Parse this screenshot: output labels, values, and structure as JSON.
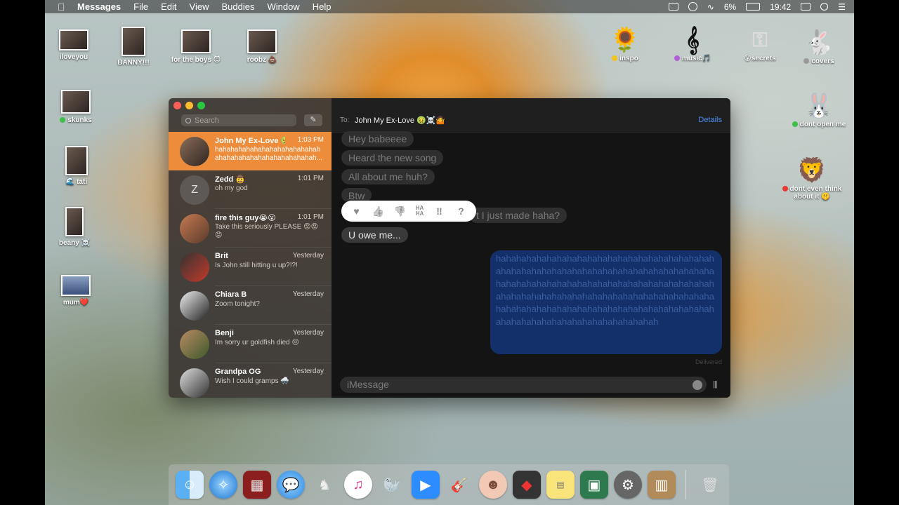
{
  "menubar": {
    "app_name": "Messages",
    "menus": [
      "File",
      "Edit",
      "View",
      "Buddies",
      "Window",
      "Help"
    ],
    "battery": "6%",
    "clock": "19:42"
  },
  "desktop": {
    "left_icons": [
      {
        "label": "iloveyou"
      },
      {
        "label": "BANNY!!!"
      },
      {
        "label": "for the boys 😈"
      },
      {
        "label": "roobz 💩"
      },
      {
        "label": "skunks"
      },
      {
        "label": "🌊 tati"
      },
      {
        "label": "beany ☠️"
      },
      {
        "label": "mum❤️"
      }
    ],
    "right_icons": [
      {
        "label": "inspo",
        "tag_color": "#f0c419"
      },
      {
        "label": "music🎵",
        "tag_color": "#b25ed8"
      },
      {
        "label": "😮secrets",
        "tag_color": ""
      },
      {
        "label": "covers",
        "tag_color": "#9a9a9a"
      },
      {
        "label": "dont open me",
        "tag_color": "#3fbf4a"
      },
      {
        "label": "dont even think about it 🤫",
        "tag_color": "#e53935"
      }
    ]
  },
  "sidebar": {
    "search_placeholder": "Search",
    "conversations": [
      {
        "name": "John My Ex-Love 🤢…",
        "time": "1:03 PM",
        "preview": "hahahahahahahahahahahahahahahahahahahahahahahahahahah...",
        "active": true
      },
      {
        "name": "Zedd 🤠",
        "time": "1:01 PM",
        "preview": "oh my god",
        "letter": "Z"
      },
      {
        "name": "fire this guy😭😮",
        "time": "1:01 PM",
        "preview": "Take this seriously PLEASE 😡😡😡"
      },
      {
        "name": "Brit",
        "time": "Yesterday",
        "preview": "Is John still hitting u up?!?!"
      },
      {
        "name": "Chiara B",
        "time": "Yesterday",
        "preview": "Zoom tonight?"
      },
      {
        "name": "Benji",
        "time": "Yesterday",
        "preview": "Im sorry ur goldfish died 😔"
      },
      {
        "name": "Grandpa OG",
        "time": "Yesterday",
        "preview": "Wish I could gramps 🌨️"
      }
    ]
  },
  "chat": {
    "to_label": "To:",
    "recipient": "John My Ex-Love 🤢☠️🤷",
    "details_label": "Details",
    "messages": [
      {
        "text": "Hey babeeee"
      },
      {
        "text": "Heard the new song"
      },
      {
        "text": "All about me huh?"
      },
      {
        "text": "Btw"
      },
      {
        "text": "t I just made haha?"
      },
      {
        "text": "U owe me..."
      }
    ],
    "sent_message": "hahahahahahahahahahahahahahahahahahahahahahahahahahahahahahahahahahahahahahahahahahahahahahahahahahahahahahahahahahahahahahahahahahahahahahahahahahahahahahahahahahahahahahahahahahahahahahahahahahahahahahahahahahahahahahahahahahahahahahahahahahahah",
    "delivered_label": "Delivered",
    "tapbacks": [
      "♥",
      "👍",
      "👎",
      "HA HA",
      "‼",
      "?"
    ],
    "input_placeholder": "iMessage"
  },
  "dock": {
    "apps": [
      "finder",
      "safari",
      "photo-booth",
      "messages",
      "inkscape",
      "itunes",
      "seal",
      "zoom",
      "garageband",
      "face-app",
      "photo-app",
      "stickies",
      "preview",
      "system-preferences",
      "contacts"
    ],
    "trash": "trash"
  }
}
